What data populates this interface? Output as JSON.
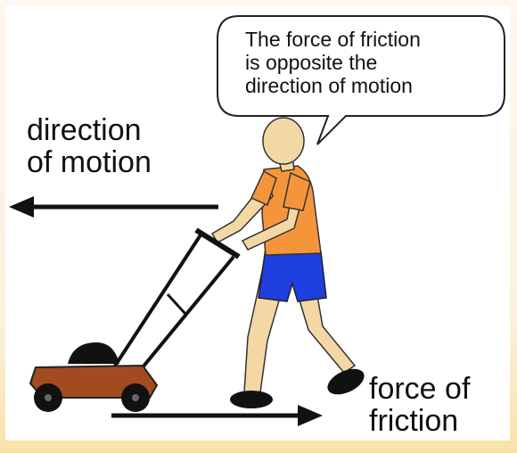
{
  "diagram": {
    "speech_bubble": "The force of friction\nis opposite the\ndirection of motion",
    "motion_label": "direction\nof motion",
    "friction_label": "force of\nfriction"
  }
}
